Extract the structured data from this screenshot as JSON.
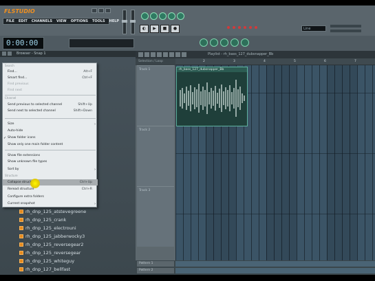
{
  "app": {
    "logo": "FLSTUDIO"
  },
  "menubar": [
    "FILE",
    "EDIT",
    "CHANNELS",
    "VIEW",
    "OPTIONS",
    "TOOLS",
    "HELP"
  ],
  "time_display": "0:00:00",
  "tempo": "Line",
  "browser": {
    "title": "Browser - Snap 1",
    "items": [
      "rh_dnp_125_atstevegreene",
      "rh_dnp_125_crank",
      "rh_dnp_125_electrouni",
      "rh_dnp_125_jabberwocky3",
      "rh_dnp_125_reversegear2",
      "rh_dnp_125_reversegear",
      "rh_dnp_125_whiteguy",
      "rh_dnp_127_bellfast"
    ]
  },
  "context_menu": {
    "header_search": "Search",
    "find": {
      "label": "Find...",
      "shortcut": "Alt+F"
    },
    "smart_find": {
      "label": "Smart find...",
      "shortcut": "Ctrl+F"
    },
    "find_previous": {
      "label": "Find previous"
    },
    "find_next": {
      "label": "Find next"
    },
    "header_channel": "Channel",
    "send_previous": {
      "label": "Send previous to selected channel",
      "shortcut": "Shift+Up"
    },
    "send_next": {
      "label": "Send next to selected channel",
      "shortcut": "Shift+Down"
    },
    "size": {
      "label": "Size"
    },
    "auto_hide": {
      "label": "Auto-hide"
    },
    "show_folder_icons": {
      "label": "Show folder icons"
    },
    "show_one_folder": {
      "label": "Show only one main folder content"
    },
    "show_extensions": {
      "label": "Show file extensions"
    },
    "show_unknown": {
      "label": "Show unknown file types"
    },
    "sort_by": {
      "label": "Sort by"
    },
    "header_structure": "Structure",
    "collapse_structure": {
      "label": "Collapse structure",
      "shortcut": "Ctrl+Up"
    },
    "reread_structure": {
      "label": "Reread structure",
      "shortcut": "Ctrl+R"
    },
    "configure_folders": {
      "label": "Configure extra folders"
    },
    "current_snapshot": {
      "label": "Current snapshot"
    }
  },
  "playlist": {
    "title": "Playlist - rh_bass_127_dubsnapper_Bb",
    "header_label": "Selection / Loop",
    "ruler": [
      "2",
      "3",
      "4",
      "5",
      "6",
      "7"
    ],
    "tracks": [
      "Track 1",
      "Track 2",
      "Track 3"
    ],
    "clip_title": "rh_bass_127_dubsnapper_Bb",
    "patterns": [
      "Pattern 1",
      "Pattern 2"
    ]
  },
  "colors": {
    "accent": "#f09020",
    "clip": "#5fb3a0"
  }
}
